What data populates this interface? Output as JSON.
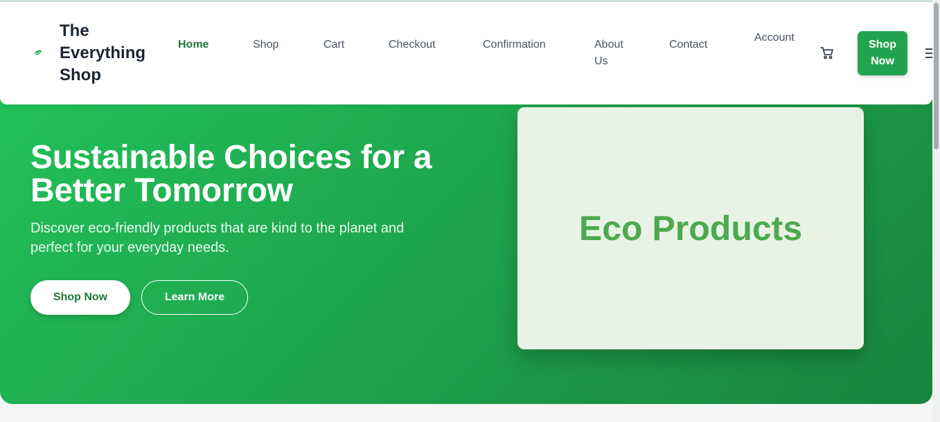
{
  "brand": {
    "name": "The Everything Shop",
    "logo_icon": "leaf-icon"
  },
  "nav": {
    "items": [
      {
        "label": "Home",
        "active": true
      },
      {
        "label": "Shop",
        "active": false
      },
      {
        "label": "Cart",
        "active": false
      },
      {
        "label": "Checkout",
        "active": false
      },
      {
        "label": "Confirmation",
        "active": false
      },
      {
        "label": "About Us",
        "active": false
      },
      {
        "label": "Contact",
        "active": false
      },
      {
        "label": "Account",
        "active": false
      }
    ],
    "cart_icon": "cart-icon",
    "cta_label": "Shop Now",
    "menu_icon": "hamburger-menu-icon"
  },
  "hero": {
    "title": "Sustainable Choices for a Better Tomorrow",
    "subtitle": "Discover eco-friendly products that are kind to the planet and perfect for your everyday needs.",
    "primary_button": "Shop Now",
    "secondary_button": "Learn More",
    "card_text": "Eco Products"
  },
  "colors": {
    "accent": "#22a34f",
    "hero_gradient_start": "#22c05a",
    "hero_gradient_end": "#18843c",
    "active_nav": "#1f7a3a",
    "card_bg": "#e9f3e5",
    "card_text": "#4caa4e"
  }
}
